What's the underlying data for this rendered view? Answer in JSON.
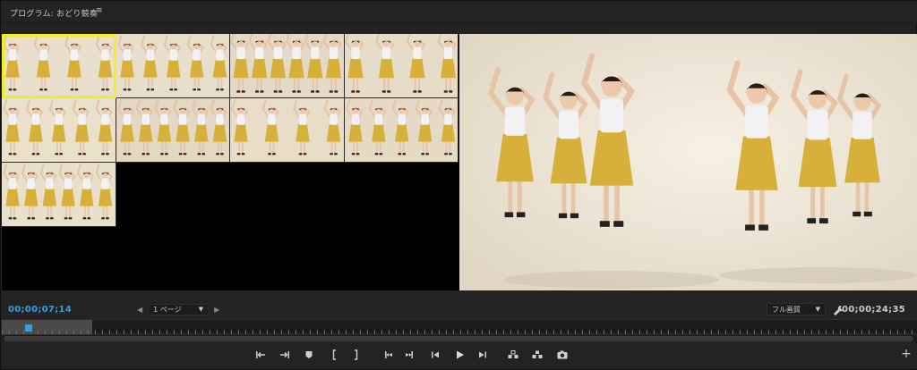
{
  "panel": {
    "title": "プログラム: おどり競奏",
    "menu_icon": "hamburger-icon"
  },
  "grid": {
    "selected_index": 0,
    "tiles": [
      {
        "name": "camera-1",
        "bg": "#e8dfcc"
      },
      {
        "name": "camera-2",
        "bg": "#e7decb"
      },
      {
        "name": "camera-3",
        "bg": "#e3d9c6"
      },
      {
        "name": "camera-4",
        "bg": "#e6dcc8"
      },
      {
        "name": "camera-5",
        "bg": "#eae1cd"
      },
      {
        "name": "camera-6",
        "bg": "#e2d8c4"
      },
      {
        "name": "camera-7",
        "bg": "#e7ddc9"
      },
      {
        "name": "camera-8",
        "bg": "#e4dac6"
      },
      {
        "name": "camera-9",
        "bg": "#e9e0cc"
      }
    ]
  },
  "timecode": {
    "current": "00;00;07;14",
    "duration": "00;00;24;35"
  },
  "pager": {
    "label": "1 ページ"
  },
  "quality": {
    "label": "フル画質"
  },
  "playback": {
    "position_fraction": 0.029,
    "in_range_fraction": 0.099
  },
  "transport": {
    "buttons": [
      {
        "name": "go-to-in-button",
        "icon": "go-to-in-icon"
      },
      {
        "name": "go-to-out-button",
        "icon": "go-to-out-icon"
      },
      {
        "name": "add-marker-button",
        "icon": "marker-icon"
      },
      {
        "name": "mark-in-button",
        "icon": "mark-in-icon"
      },
      {
        "name": "mark-out-button",
        "icon": "mark-out-icon"
      },
      {
        "name": "go-to-previous-edit-button",
        "icon": "previous-edit-icon"
      },
      {
        "name": "go-to-next-edit-button",
        "icon": "next-edit-icon"
      },
      {
        "name": "step-back-button",
        "icon": "step-back-icon"
      },
      {
        "name": "play-button",
        "icon": "play-icon"
      },
      {
        "name": "step-forward-button",
        "icon": "step-forward-icon"
      },
      {
        "name": "lift-button",
        "icon": "lift-icon"
      },
      {
        "name": "extract-button",
        "icon": "extract-icon"
      },
      {
        "name": "export-frame-button",
        "icon": "camera-icon"
      }
    ]
  },
  "colors": {
    "accent": "#3a9cdc",
    "selection": "#f2ed2a",
    "skirt": "#d6b03a",
    "background": "#232323"
  }
}
